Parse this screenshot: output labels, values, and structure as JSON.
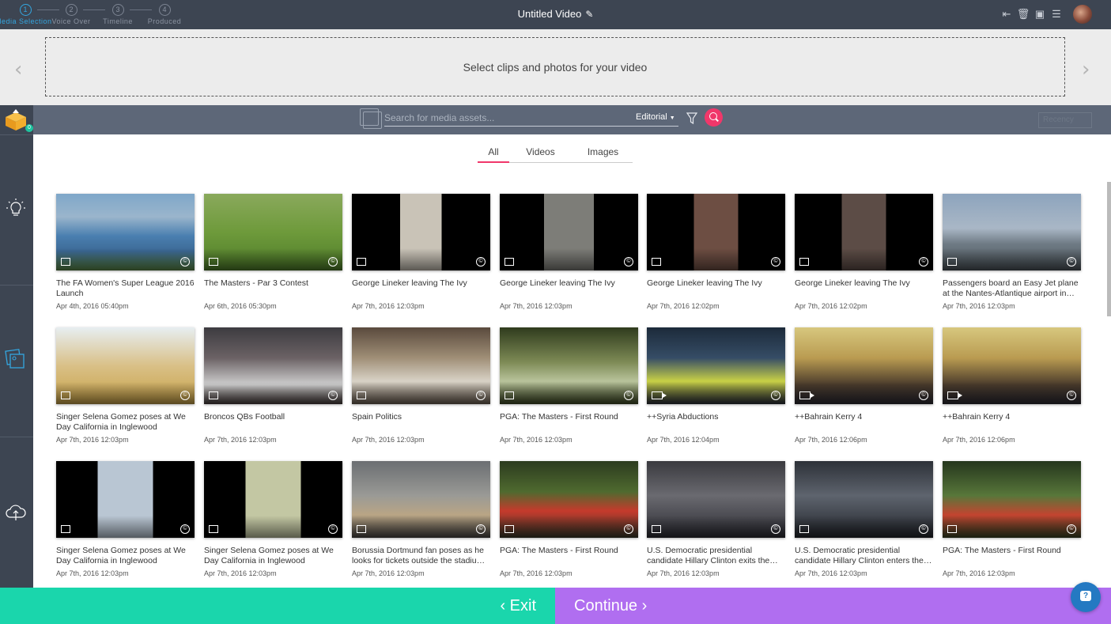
{
  "steps": [
    {
      "num": "1",
      "label": "Media Selection"
    },
    {
      "num": "2",
      "label": "Voice Over"
    },
    {
      "num": "3",
      "label": "Timeline"
    },
    {
      "num": "4",
      "label": "Produced"
    }
  ],
  "header": {
    "title": "Untitled Video"
  },
  "dropzone": {
    "text": "Select clips and photos for your video"
  },
  "search": {
    "placeholder": "Search for media assets...",
    "scope": "Editorial",
    "sort": "Recency"
  },
  "basket": {
    "count": "0"
  },
  "tabs": [
    {
      "label": "All"
    },
    {
      "label": "Videos"
    },
    {
      "label": "Images"
    }
  ],
  "assets": [
    {
      "title": "The FA Women's Super League 2016 Launch",
      "date": "Apr 4th, 2016   05:40pm",
      "type": "image"
    },
    {
      "title": "The Masters - Par 3 Contest",
      "date": "Apr 6th, 2016   05:30pm",
      "type": "image"
    },
    {
      "title": "George Lineker leaving The Ivy",
      "date": "Apr 7th, 2016   12:03pm",
      "type": "image"
    },
    {
      "title": "George Lineker leaving The Ivy",
      "date": "Apr 7th, 2016   12:03pm",
      "type": "image"
    },
    {
      "title": "George Lineker leaving The Ivy",
      "date": "Apr 7th, 2016   12:02pm",
      "type": "image"
    },
    {
      "title": "George Lineker leaving The Ivy",
      "date": "Apr 7th, 2016   12:02pm",
      "type": "image"
    },
    {
      "title": "Passengers board an Easy Jet plane at the Nantes-Atlantique airport in…",
      "date": "Apr 7th, 2016   12:03pm",
      "type": "image"
    },
    {
      "title": "Singer Selena Gomez poses at We Day California in Inglewood",
      "date": "Apr 7th, 2016   12:03pm",
      "type": "image"
    },
    {
      "title": "Broncos QBs Football",
      "date": "Apr 7th, 2016   12:03pm",
      "type": "image"
    },
    {
      "title": "Spain Politics",
      "date": "Apr 7th, 2016   12:03pm",
      "type": "image"
    },
    {
      "title": "PGA: The Masters - First Round",
      "date": "Apr 7th, 2016   12:03pm",
      "type": "image"
    },
    {
      "title": "++Syria Abductions",
      "date": "Apr 7th, 2016   12:04pm",
      "type": "video"
    },
    {
      "title": "++Bahrain Kerry 4",
      "date": "Apr 7th, 2016   12:06pm",
      "type": "video"
    },
    {
      "title": "++Bahrain Kerry 4",
      "date": "Apr 7th, 2016   12:06pm",
      "type": "video"
    },
    {
      "title": "Singer Selena Gomez poses at We Day California in Inglewood",
      "date": "Apr 7th, 2016   12:03pm",
      "type": "image"
    },
    {
      "title": "Singer Selena Gomez poses at We Day California in Inglewood",
      "date": "Apr 7th, 2016   12:03pm",
      "type": "image"
    },
    {
      "title": "Borussia Dortmund fan poses as he looks for tickets outside the stadiu…",
      "date": "Apr 7th, 2016   12:03pm",
      "type": "image"
    },
    {
      "title": "PGA: The Masters - First Round",
      "date": "Apr 7th, 2016   12:03pm",
      "type": "image"
    },
    {
      "title": "U.S. Democratic presidential candidate Hillary Clinton exits the…",
      "date": "Apr 7th, 2016   12:03pm",
      "type": "image"
    },
    {
      "title": "U.S. Democratic presidential candidate Hillary Clinton enters the…",
      "date": "Apr 7th, 2016   12:03pm",
      "type": "image"
    },
    {
      "title": "PGA: The Masters - First Round",
      "date": "Apr 7th, 2016   12:03pm",
      "type": "image"
    }
  ],
  "footer": {
    "exit": "‹ Exit",
    "continue": "Continue ›"
  },
  "colors": {
    "topbar": "#3d4552",
    "accent_pink": "#f0376a",
    "exit": "#1ad6ac",
    "continue": "#b06ef0",
    "active_step": "#33a6e0"
  }
}
